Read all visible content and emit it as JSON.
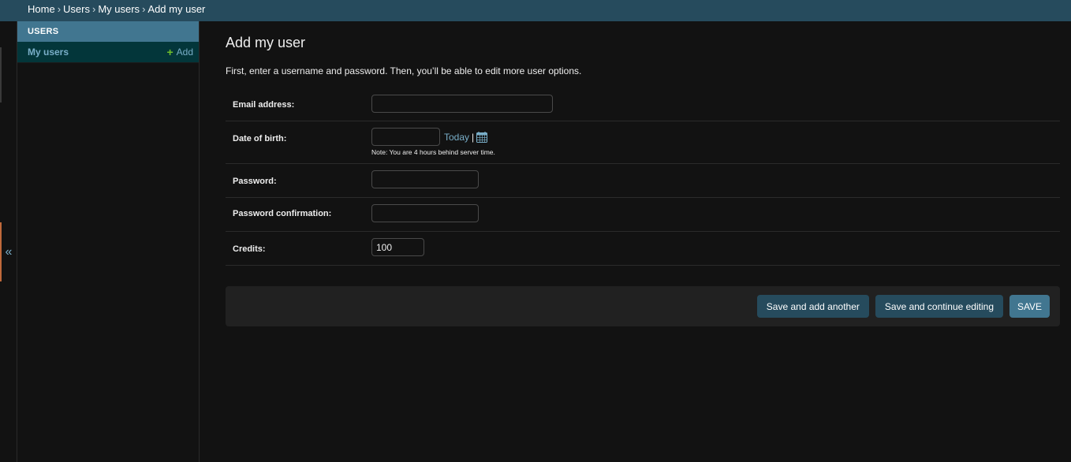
{
  "breadcrumbs": {
    "home": "Home",
    "users_app": "Users",
    "my_users": "My users",
    "current": "Add my user",
    "separator": "›"
  },
  "sidebar": {
    "module_caption": "Users",
    "model_link": "My users",
    "add_link": "Add",
    "collapse_icon": "«"
  },
  "page": {
    "title": "Add my user",
    "help": "First, enter a username and password. Then, you’ll be able to edit more user options."
  },
  "form": {
    "email": {
      "label": "Email address:",
      "value": ""
    },
    "dob": {
      "label": "Date of birth:",
      "value": "",
      "today_link": "Today",
      "pipe": "|",
      "note": "Note: You are 4 hours behind server time."
    },
    "password": {
      "label": "Password:",
      "value": ""
    },
    "password_confirmation": {
      "label": "Password confirmation:",
      "value": ""
    },
    "credits": {
      "label": "Credits:",
      "value": "100"
    }
  },
  "submit": {
    "save_add_another": "Save and add another",
    "save_continue": "Save and continue editing",
    "save": "Save"
  },
  "colors": {
    "header": "#264b5d",
    "link": "#79aec8",
    "add_plus": "#70bf2b",
    "save_button": "#417690"
  }
}
